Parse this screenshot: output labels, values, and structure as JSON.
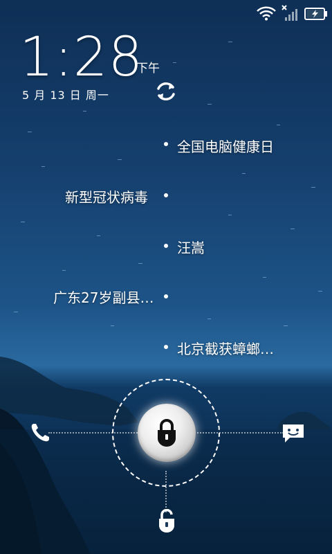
{
  "status_bar": {
    "icons": [
      "wifi-icon",
      "signal-icon",
      "battery-charging-icon"
    ]
  },
  "clock": {
    "time": "1:28",
    "period": "下午"
  },
  "date": "5 月 13 日 周一",
  "refresh_icon": "refresh-icon",
  "news": [
    {
      "text": "全国电脑健康日",
      "side": "right"
    },
    {
      "text": "新型冠状病毒",
      "side": "left"
    },
    {
      "text": "汪嵩",
      "side": "right"
    },
    {
      "text": "广东27岁副县…",
      "side": "left"
    },
    {
      "text": "北京截获蟑螂…",
      "side": "right"
    }
  ],
  "unlock_targets": {
    "left": "phone-icon",
    "right": "message-icon",
    "bottom": "unlock-icon",
    "center": "lock-icon"
  },
  "colors": {
    "sky_top": "#0e2f56",
    "sea": "#0b2b4d",
    "accent": "#ffffff"
  }
}
